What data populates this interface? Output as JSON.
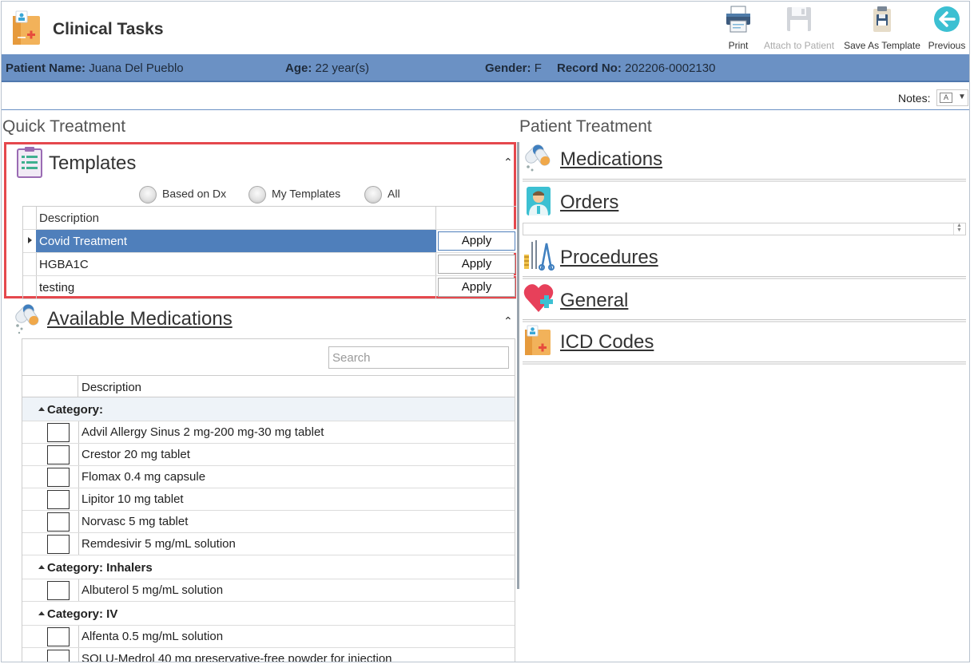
{
  "app": {
    "title": "Clinical Tasks"
  },
  "toolbar": {
    "print": "Print",
    "attach": "Attach to Patient",
    "save_template": "Save As Template",
    "previous": "Previous"
  },
  "patient": {
    "name_label": "Patient Name:",
    "name": "Juana Del Pueblo",
    "age_label": "Age:",
    "age": "22 year(s)",
    "gender_label": "Gender:",
    "gender": "F",
    "record_label": "Record No:",
    "record": "202206-0002130"
  },
  "notes": {
    "label": "Notes:",
    "icon_text": "A"
  },
  "quick_treatment": {
    "title": "Quick Treatment",
    "templates": {
      "title": "Templates",
      "filters": [
        "Based on Dx",
        "My Templates",
        "All"
      ],
      "column_header": "Description",
      "rows": [
        {
          "description": "Covid Treatment",
          "action": "Apply",
          "selected": true
        },
        {
          "description": "HGBA1C",
          "action": "Apply",
          "selected": false
        },
        {
          "description": "testing",
          "action": "Apply",
          "selected": false
        }
      ]
    },
    "available_medications": {
      "title": "Available Medications",
      "search_placeholder": "Search",
      "column_header": "Description",
      "groups": [
        {
          "label": "Category:",
          "items": [
            "Advil Allergy Sinus 2 mg-200 mg-30 mg tablet",
            "Crestor 20 mg tablet",
            "Flomax 0.4 mg capsule",
            "Lipitor 10 mg tablet",
            "Norvasc 5 mg tablet",
            "Remdesivir 5 mg/mL solution"
          ]
        },
        {
          "label": "Category: Inhalers",
          "items": [
            "Albuterol 5 mg/mL solution"
          ]
        },
        {
          "label": "Category: IV",
          "items": [
            "Alfenta 0.5 mg/mL solution",
            "SOLU-Medrol 40 mg preservative-free powder for injection"
          ]
        }
      ]
    }
  },
  "patient_treatment": {
    "title": "Patient Treatment",
    "sections": [
      "Medications",
      "Orders",
      "Procedures",
      "General",
      "ICD Codes"
    ]
  },
  "colors": {
    "patient_bar": "#6b91c4",
    "selected_row": "#4f7fbb",
    "highlight_border": "#e5484d"
  }
}
